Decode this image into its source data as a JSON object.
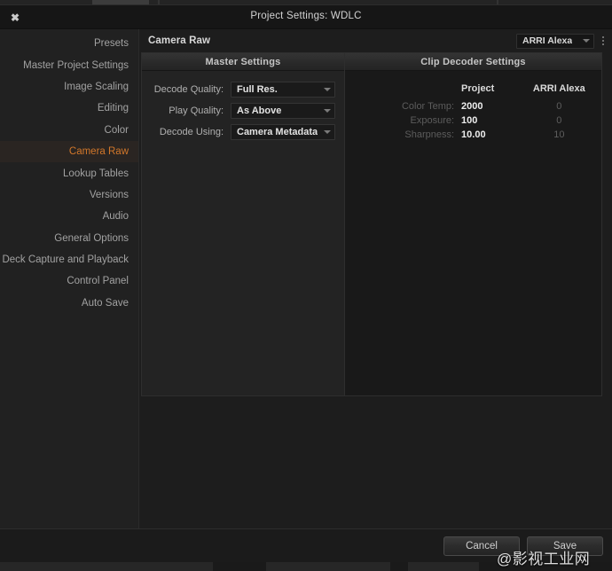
{
  "window": {
    "title": "Project Settings:  WDLC",
    "close_icon": "close-icon"
  },
  "sidebar": {
    "items": [
      {
        "label": "Presets",
        "selected": false
      },
      {
        "label": "Master Project Settings",
        "selected": false
      },
      {
        "label": "Image Scaling",
        "selected": false
      },
      {
        "label": "Editing",
        "selected": false
      },
      {
        "label": "Color",
        "selected": false
      },
      {
        "label": "Camera Raw",
        "selected": true
      },
      {
        "label": "Lookup Tables",
        "selected": false
      },
      {
        "label": "Versions",
        "selected": false
      },
      {
        "label": "Audio",
        "selected": false
      },
      {
        "label": "General Options",
        "selected": false
      },
      {
        "label": "Deck Capture and Playback",
        "selected": false
      },
      {
        "label": "Control Panel",
        "selected": false
      },
      {
        "label": "Auto Save",
        "selected": false
      }
    ],
    "selected_color": "#d2772a"
  },
  "content": {
    "title": "Camera Raw",
    "camera_select": {
      "value": "ARRI Alexa",
      "caret_icon": "chevron-down-icon",
      "menu_icon": "kebab-menu-icon"
    }
  },
  "master_settings": {
    "header": "Master Settings",
    "rows": [
      {
        "label": "Decode Quality:",
        "value": "Full Res."
      },
      {
        "label": "Play Quality:",
        "value": "As Above"
      },
      {
        "label": "Decode Using:",
        "value": "Camera Metadata"
      }
    ]
  },
  "clip_decoder": {
    "header": "Clip Decoder Settings",
    "columns": [
      "",
      "Project",
      "ARRI Alexa"
    ],
    "rows": [
      {
        "label": "Color Temp:",
        "project": "2000",
        "camera": "0"
      },
      {
        "label": "Exposure:",
        "project": "100",
        "camera": "0"
      },
      {
        "label": "Sharpness:",
        "project": "10.00",
        "camera": "10"
      }
    ]
  },
  "footer": {
    "cancel_label": "Cancel",
    "save_label": "Save"
  },
  "watermark": {
    "text": "@影视工业网"
  }
}
